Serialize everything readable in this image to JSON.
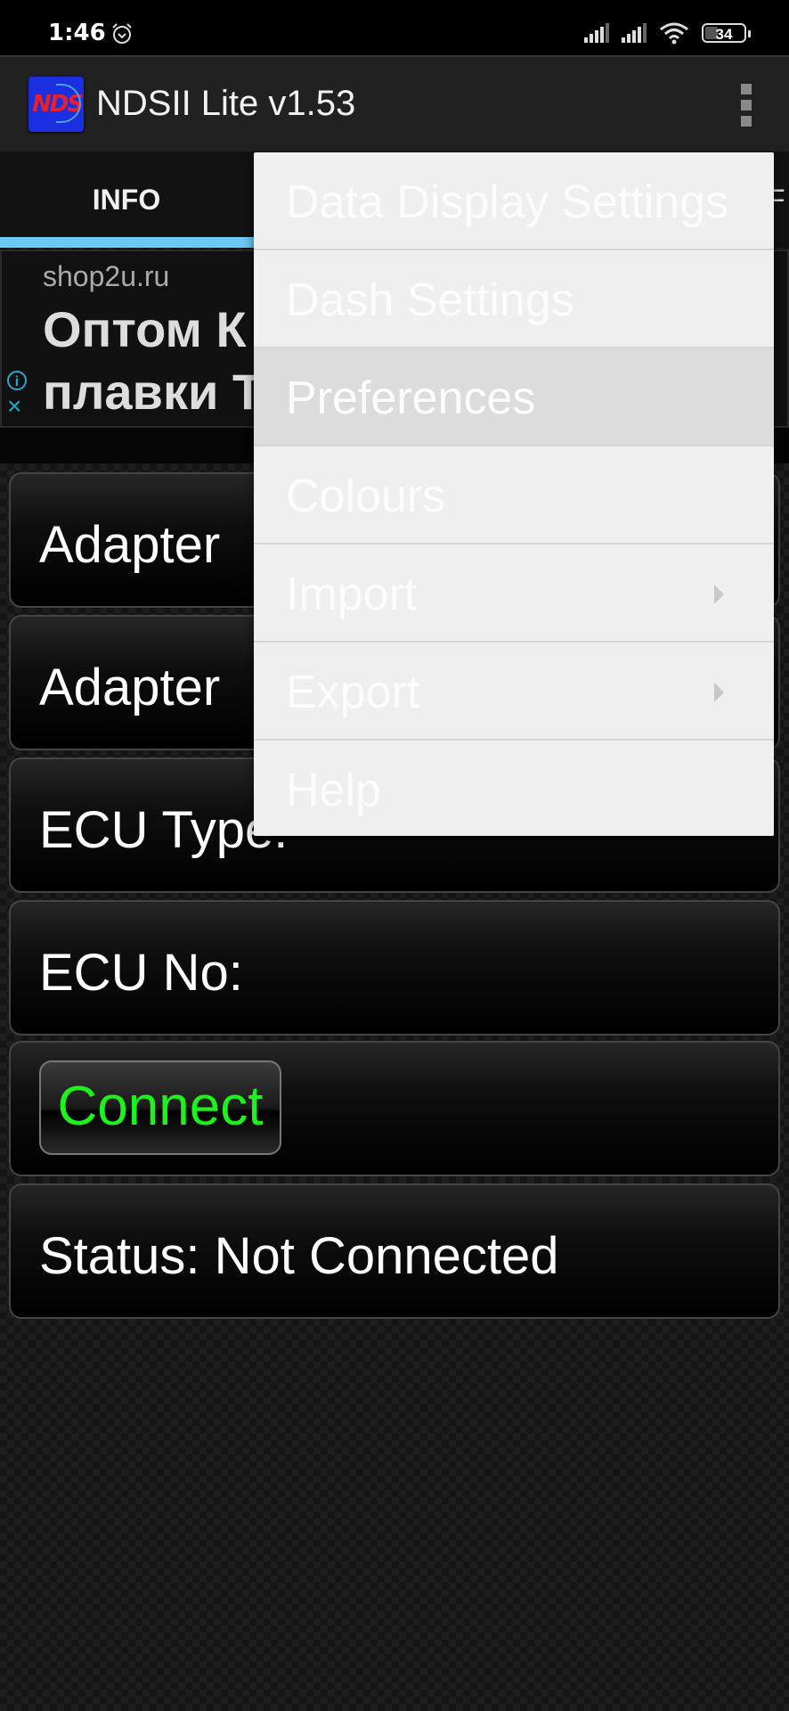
{
  "status_bar": {
    "time": "1:46",
    "alarm_icon": "alarm-clock-icon",
    "signal_icons": [
      "cell-signal-icon",
      "cell-signal-icon"
    ],
    "wifi_icon": "wifi-icon",
    "battery_level": "34"
  },
  "app_bar": {
    "icon_text": "NDS",
    "title": "NDSII Lite v1.53",
    "overflow_icon": "more-vert-icon"
  },
  "tabs": [
    {
      "label": "INFO",
      "selected": true
    },
    {
      "label": "F",
      "selected": false
    }
  ],
  "ad": {
    "domain": "shop2u.ru",
    "line1": "Оптом К",
    "line2": "плавки Т",
    "info_icon": "i",
    "close_icon": "×",
    "colors": {
      "icon": "#29a7c8"
    }
  },
  "info_rows": [
    {
      "label": "Adapter"
    },
    {
      "label": "Adapter"
    },
    {
      "label": "ECU Type:"
    },
    {
      "label": "ECU No:"
    }
  ],
  "connect_button": {
    "label": "Connect",
    "color": "#1cf21c"
  },
  "status": {
    "label": "Status: Not Connected"
  },
  "menu": {
    "items": [
      {
        "label": "Data Display Settings",
        "submenu": false,
        "highlighted": false
      },
      {
        "label": "Dash Settings",
        "submenu": false,
        "highlighted": false
      },
      {
        "label": "Preferences",
        "submenu": false,
        "highlighted": true
      },
      {
        "label": "Colours",
        "submenu": false,
        "highlighted": false
      },
      {
        "label": "Import",
        "submenu": true,
        "highlighted": false
      },
      {
        "label": "Export",
        "submenu": true,
        "highlighted": false
      },
      {
        "label": "Help",
        "submenu": false,
        "highlighted": false
      }
    ]
  },
  "colors": {
    "tab_indicator": "#6cc9f5",
    "app_bar": "#212121",
    "menu_bg": "#efefef"
  }
}
